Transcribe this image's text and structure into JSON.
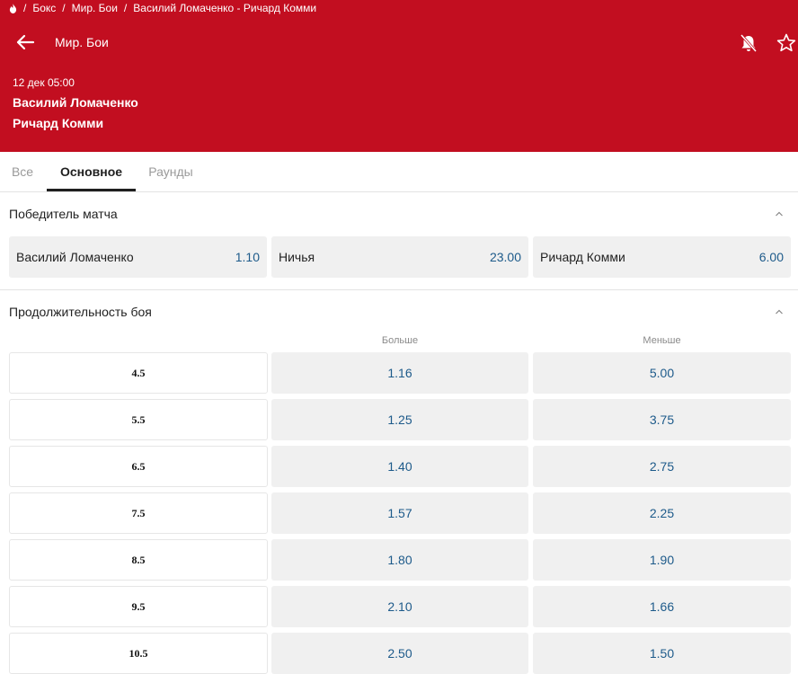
{
  "breadcrumb": {
    "items": [
      "Бокс",
      "Мир. Бои",
      "Василий Ломаченко - Ричард Комми"
    ],
    "separator": "/"
  },
  "header": {
    "title": "Мир. Бои",
    "date": "12 дек 05:00",
    "team1": "Василий Ломаченко",
    "team2": "Ричард Комми",
    "bg_color": "#c20e20"
  },
  "tabs": [
    {
      "label": "Все",
      "active": false
    },
    {
      "label": "Основное",
      "active": true
    },
    {
      "label": "Раунды",
      "active": false
    }
  ],
  "winner_market": {
    "title": "Победитель матча",
    "outcomes": [
      {
        "label": "Василий Ломаченко",
        "odds": "1.10"
      },
      {
        "label": "Ничья",
        "odds": "23.00"
      },
      {
        "label": "Ричард Комми",
        "odds": "6.00"
      }
    ]
  },
  "duration_market": {
    "title": "Продолжительность боя",
    "col_over": "Больше",
    "col_under": "Меньше",
    "rows": [
      {
        "line": "4.5",
        "over": "1.16",
        "under": "5.00"
      },
      {
        "line": "5.5",
        "over": "1.25",
        "under": "3.75"
      },
      {
        "line": "6.5",
        "over": "1.40",
        "under": "2.75"
      },
      {
        "line": "7.5",
        "over": "1.57",
        "under": "2.25"
      },
      {
        "line": "8.5",
        "over": "1.80",
        "under": "1.90"
      },
      {
        "line": "9.5",
        "over": "2.10",
        "under": "1.66"
      },
      {
        "line": "10.5",
        "over": "2.50",
        "under": "1.50"
      }
    ]
  },
  "icons": {
    "home": "fire-icon",
    "back": "arrow-left-icon",
    "bell": "bell-off-icon",
    "star": "star-icon",
    "collapse": "chevron-up-icon"
  },
  "colors": {
    "accent": "#c20e20",
    "odds": "#1d5a8a",
    "cell_bg": "#f0f0f0"
  }
}
